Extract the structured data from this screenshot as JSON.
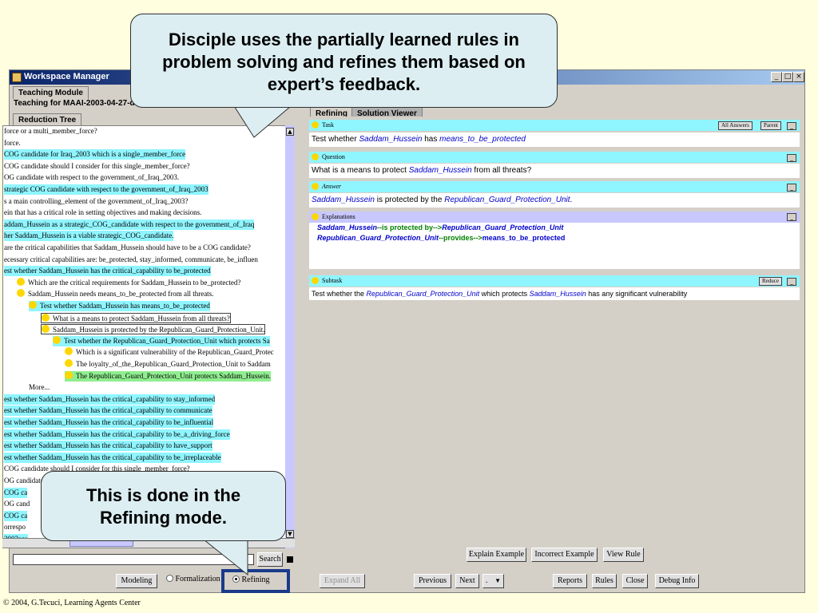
{
  "window": {
    "title": "Workspace Manager",
    "min": "_",
    "max": "□",
    "close": "×"
  },
  "tabs": {
    "module": "Teaching Module",
    "teaching_for": "Teaching for MAAI-2003-04-27-de",
    "reduction_tree": "Reduction Tree",
    "refining": "Refining",
    "solution_viewer": "Solution Viewer"
  },
  "tree": [
    {
      "text": "force or a multi_member_force?",
      "style": "plain",
      "indent": 0
    },
    {
      "text": "force.",
      "style": "plain",
      "indent": 0
    },
    {
      "text": "COG candidate for Iraq_2003 which is a single_member_force",
      "style": "cyan",
      "indent": 0
    },
    {
      "text": "COG candidate should I consider for this single_member_force?",
      "style": "plain",
      "indent": 0
    },
    {
      "text": "OG candidate with respect to the government_of_Iraq_2003.",
      "style": "plain",
      "indent": 0
    },
    {
      "text": "strategic COG candidate with respect to the government_of_Iraq_2003",
      "style": "cyan",
      "indent": 0
    },
    {
      "text": "s a main controlling_element of the government_of_Iraq_2003?",
      "style": "plain",
      "indent": 0
    },
    {
      "text": "ein that has a critical role in setting objectives and making decisions.",
      "style": "plain",
      "indent": 0
    },
    {
      "text": "addam_Hussein as a strategic_COG_candidate with respect to the government_of_Iraq",
      "style": "cyan",
      "indent": 0
    },
    {
      "text": "her Saddam_Hussein is a viable strategic_COG_candidate.",
      "style": "cyan",
      "indent": 0
    },
    {
      "text": "are the critical capabilities that Saddam_Hussein should have to be a COG candidate?",
      "style": "plain",
      "indent": 0
    },
    {
      "text": "ecessary critical capabilities are: be_protected, stay_informed, communicate, be_influen",
      "style": "plain",
      "indent": 0
    },
    {
      "text": "est whether Saddam_Hussein has the critical_capability to be_protected",
      "style": "cyan",
      "indent": 0
    },
    {
      "text": "Which are the critical requirements for Saddam_Hussein to be_protected?",
      "style": "plain",
      "indent": 1,
      "dot": true
    },
    {
      "text": "Saddam_Hussein needs means_to_be_protected from all threats.",
      "style": "plain",
      "indent": 1,
      "dot": true
    },
    {
      "text": "Test whether Saddam_Hussein has means_to_be_protected",
      "style": "cyan",
      "indent": 2,
      "dot": true
    },
    {
      "text": "What is a means to protect Saddam_Hussein from all threats?",
      "style": "boxed",
      "indent": 3,
      "dot": true
    },
    {
      "text": "Saddam_Hussein is protected by the Republican_Guard_Protection_Unit.",
      "style": "boxed",
      "indent": 3,
      "dot": true
    },
    {
      "text": "Test whether the Republican_Guard_Protection_Unit which protects Sa",
      "style": "cyan",
      "indent": 4,
      "dot": true
    },
    {
      "text": "Which is a significant vulnerability of the Republican_Guard_Protec",
      "style": "plain",
      "indent": 5,
      "dot": true
    },
    {
      "text": "The loyalty_of_the_Republican_Guard_Protection_Unit to Saddam",
      "style": "plain",
      "indent": 5,
      "dot": true
    },
    {
      "text": "The Republican_Guard_Protection_Unit protects Saddam_Hussein.",
      "style": "green",
      "indent": 5,
      "dot": true
    },
    {
      "text": "More...",
      "style": "plain",
      "indent": 2
    },
    {
      "text": "est whether Saddam_Hussein has the critical_capability to stay_informed",
      "style": "cyan",
      "indent": 0
    },
    {
      "text": "est whether Saddam_Hussein has the critical_capability to communicate",
      "style": "cyan",
      "indent": 0
    },
    {
      "text": "est whether Saddam_Hussein has the critical_capability to be_influential",
      "style": "cyan",
      "indent": 0
    },
    {
      "text": "est whether Saddam_Hussein has the critical_capability to be_a_driving_force",
      "style": "cyan",
      "indent": 0
    },
    {
      "text": "est whether Saddam_Hussein has the critical_capability to have_support",
      "style": "cyan",
      "indent": 0
    },
    {
      "text": "est whether Saddam_Hussein has the critical_capability to be_irreplaceable",
      "style": "cyan",
      "indent": 0
    },
    {
      "text": "COG candidate should I consider for this single_member_force?",
      "style": "plain",
      "indent": 0
    },
    {
      "text": "OG candidate with respect to the people_of_Iraq_2003.",
      "style": "plain",
      "indent": 0
    },
    {
      "text": "COG ca",
      "style": "cyan",
      "indent": 0
    },
    {
      "text": "OG cand",
      "style": "plain",
      "indent": 0
    },
    {
      "text": "COG ca",
      "style": "cyan",
      "indent": 0
    },
    {
      "text": "orrespo",
      "style": "plain",
      "indent": 0
    },
    {
      "text": "2003sce",
      "style": "cyan",
      "indent": 0
    }
  ],
  "search": {
    "button": "Search",
    "value": ""
  },
  "sections": {
    "task": {
      "header": "Task",
      "btn1": "All Answers",
      "btn2": "Parent",
      "pre": "Test whether ",
      "ent1": "Saddam_Hussein",
      "mid": " has ",
      "ent2": "means_to_be_protected"
    },
    "question": {
      "header": "Question",
      "pre": "What is a means to protect ",
      "ent1": "Saddam_Hussein",
      "post": " from all threats?"
    },
    "answer": {
      "header": "Answer",
      "ent1": "Saddam_Hussein",
      "mid": " is protected by the ",
      "ent2": "Republican_Guard_Protection_Unit",
      "post": "."
    },
    "explanations": {
      "header": "Explanations",
      "l1a": "Saddam_Hussein",
      "l1b": "--is protected by-->",
      "l1c": "Republican_Guard_Protection_Unit",
      "l2a": "Republican_Guard_Protection_Unit",
      "l2b": "--provides-->",
      "l2c": "means_to_be_protected"
    },
    "subtask": {
      "header": "Subtask",
      "btn": "Reduce",
      "pre": "Test whether the ",
      "ent1": "Republican_Guard_Protection_Unit",
      "mid": " which protects ",
      "ent2": "Saddam_Hussein",
      "post": " has any significant vulnerability"
    }
  },
  "right_buttons": {
    "explain": "Explain Example",
    "incorrect": "Incorrect Example",
    "view_rule": "View Rule"
  },
  "bottom": {
    "modeling": "Modeling",
    "formalization": "Formalization",
    "refining": "Refining",
    "expand_all": "Expand All",
    "previous": "Previous",
    "next": "Next",
    "dot": ".",
    "reports": "Reports",
    "rules": "Rules",
    "close": "Close",
    "debug": "Debug Info"
  },
  "callouts": {
    "top": "Disciple uses the partially learned rules in problem solving and refines them based on expert’s feedback.",
    "bottom": "This is done in the Refining mode."
  },
  "footer": "© 2004, G.Tecuci, Learning Agents Center",
  "colors": {
    "cyan": "#8ff5ff",
    "green": "#90ee90",
    "blue_entity": "#0000cd",
    "title_dark": "#0a246a",
    "accent_border": "#1a3a8a"
  }
}
